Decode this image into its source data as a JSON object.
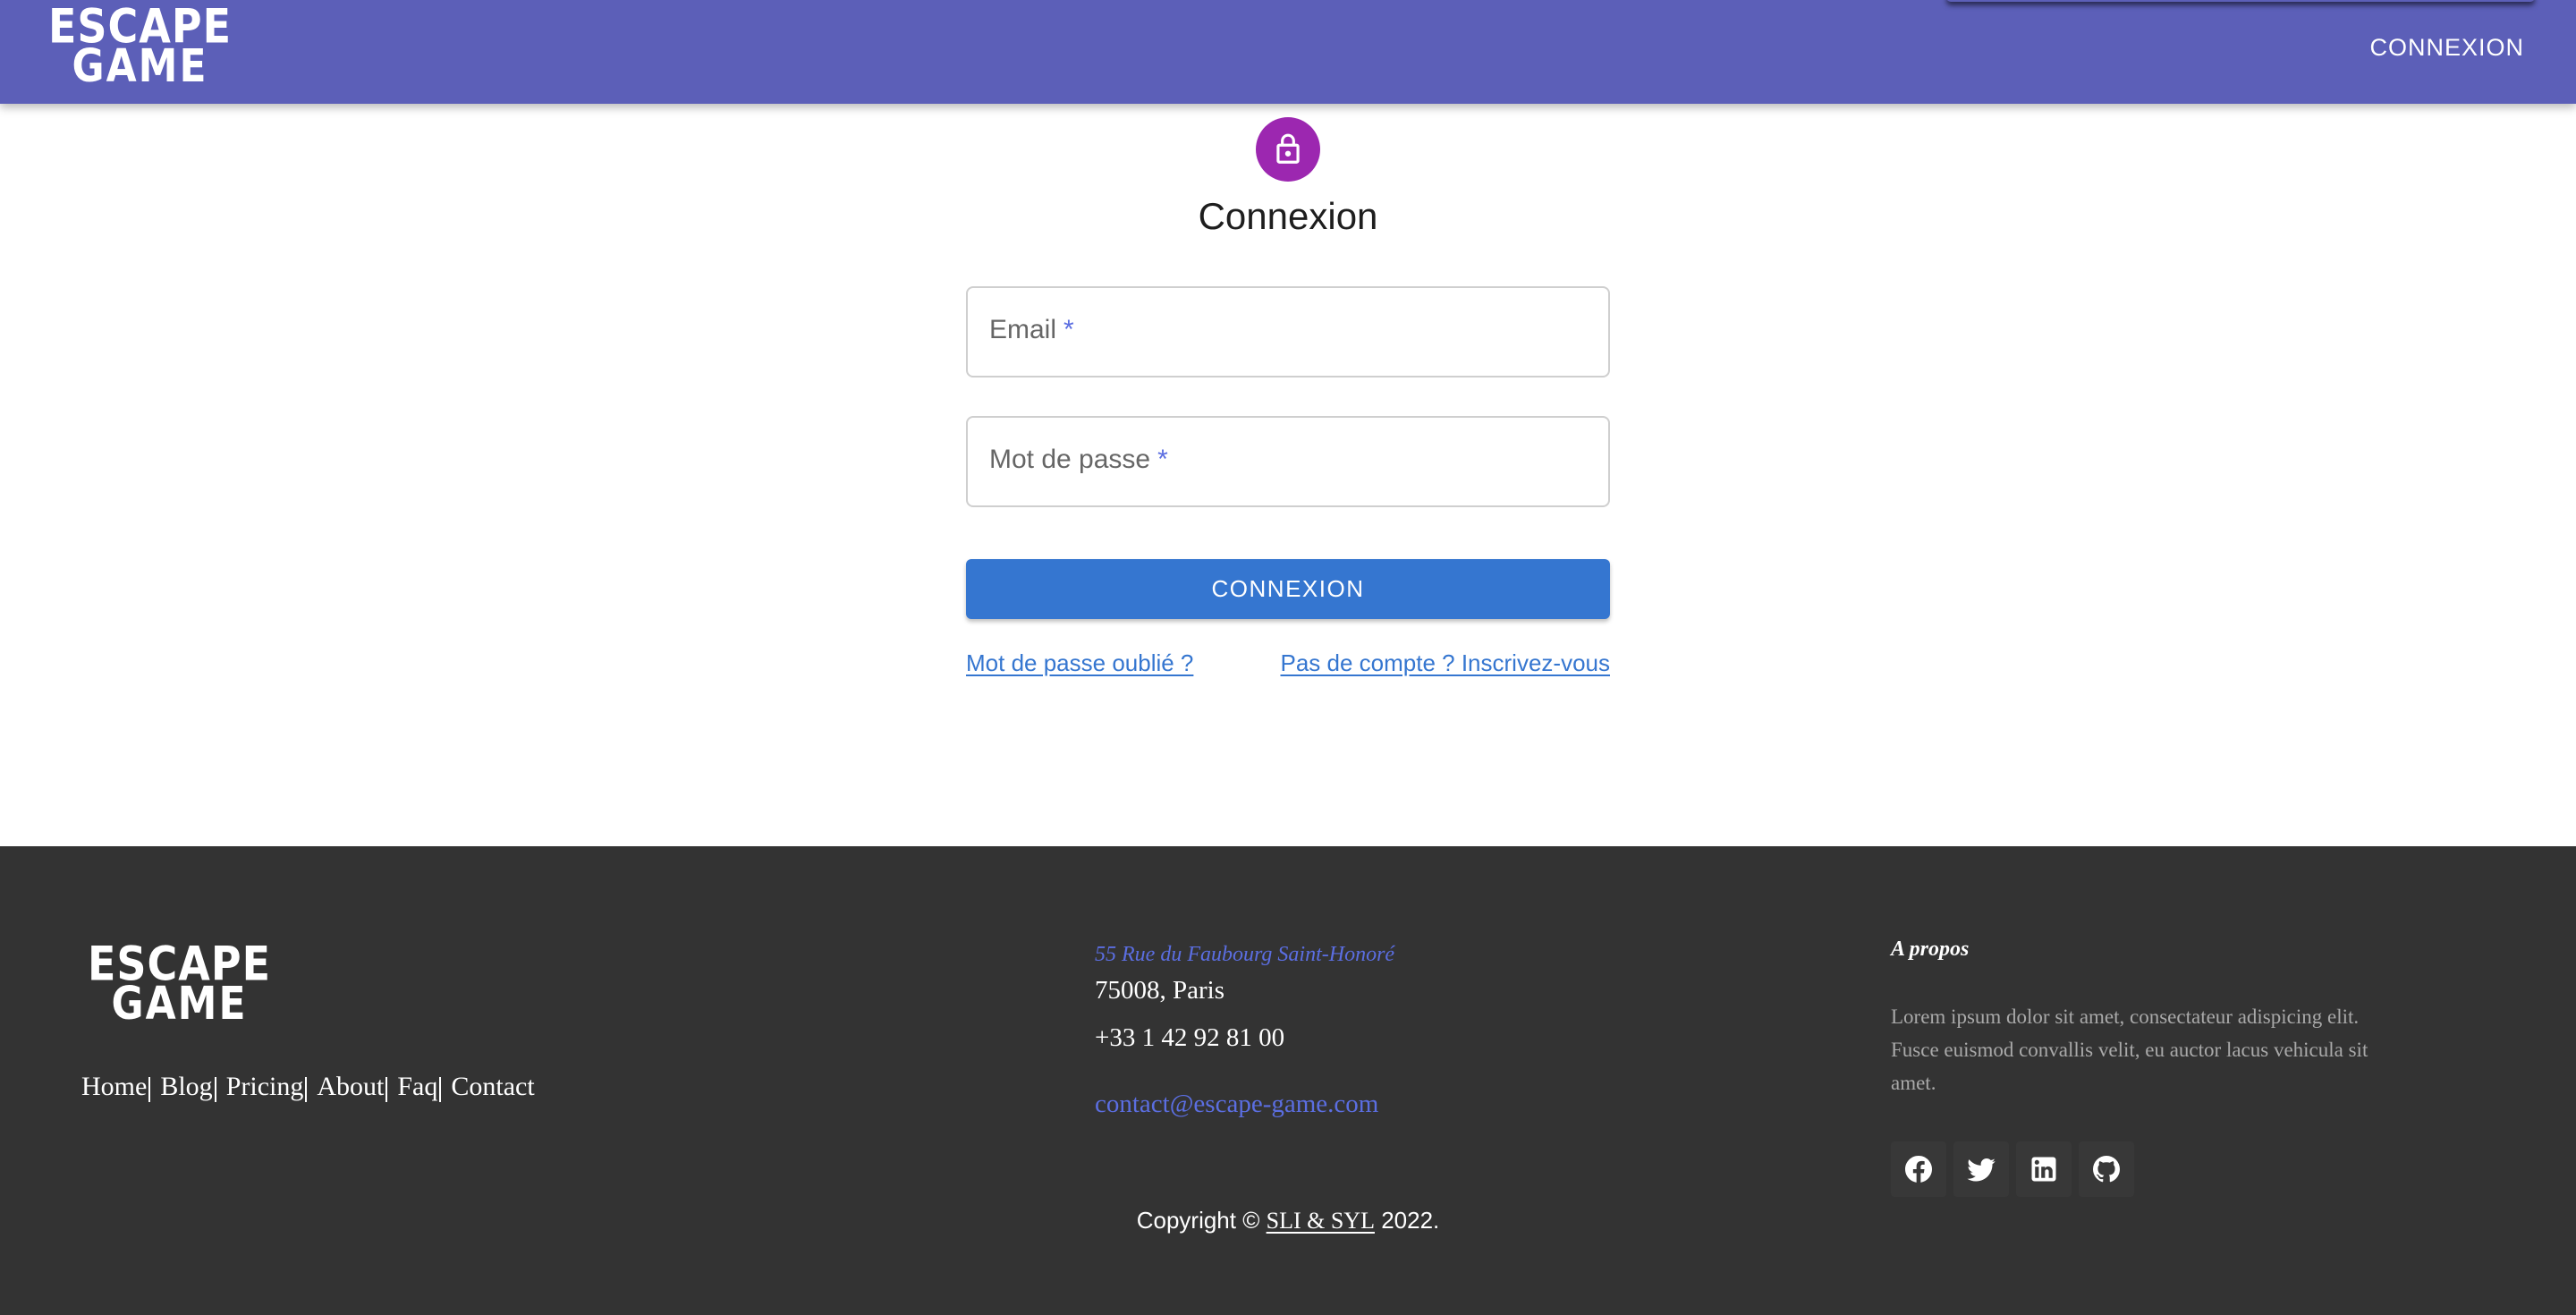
{
  "header": {
    "logo_line1": "ESCAPE",
    "logo_line2": "GAME",
    "login_label": "CONNEXION"
  },
  "form": {
    "title": "Connexion",
    "email_label": "Email",
    "password_label": "Mot de passe",
    "required_mark": "*",
    "submit_label": "CONNEXION",
    "forgot_link": "Mot de passe oublié ?",
    "signup_link": "Pas de compte ? Inscrivez-vous"
  },
  "footer": {
    "logo_line1": "ESCAPE",
    "logo_line2": "GAME",
    "nav": [
      "Home",
      "Blog",
      "Pricing",
      "About",
      "Faq",
      "Contact"
    ],
    "street": "55 Rue du Faubourg Saint-Honoré",
    "city": "75008, Paris",
    "phone": "+33 1 42 92 81 00",
    "email": "contact@escape-game.com",
    "about_title": "A propos",
    "about_text": "Lorem ipsum dolor sit amet, consectateur adispicing elit. Fusce euismod convallis velit, eu auctor lacus vehicula sit amet.",
    "socials": [
      "facebook-icon",
      "twitter-icon",
      "linkedin-icon",
      "github-icon"
    ],
    "copyright_prefix": "Copyright ©",
    "copyright_brand": "SLI & SYL",
    "copyright_suffix": "2022."
  },
  "colors": {
    "appbar": "#5c5fb8",
    "avatar": "#9c27b0",
    "primary": "#3576d0",
    "accent": "#5b6ee1",
    "footer": "#333333"
  }
}
